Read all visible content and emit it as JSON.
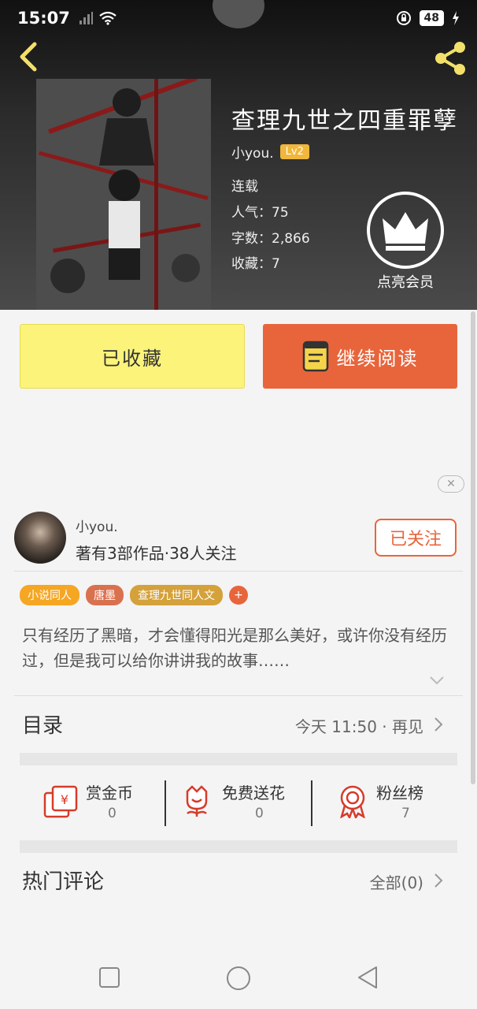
{
  "status": {
    "time": "15:07",
    "battery": "48"
  },
  "book": {
    "title": "查理九世之四重罪孽",
    "author": "小you.",
    "level": "Lv2",
    "state": "连载",
    "popularity_label": "人气：",
    "popularity": "75",
    "words_label": "字数：",
    "words": "2,866",
    "favorites_label": "收藏：",
    "favorites": "7"
  },
  "vip": {
    "label": "点亮会员"
  },
  "actions": {
    "collected": "已收藏",
    "continue_reading": "继续阅读"
  },
  "author_card": {
    "name": "小you.",
    "stats": "著有3部作品·38人关注",
    "follow": "已关注"
  },
  "tags": [
    {
      "label": "小说同人",
      "color": "#f5a623"
    },
    {
      "label": "唐墨",
      "color": "#d9714f"
    },
    {
      "label": "查理九世同人文",
      "color": "#d4a13a"
    },
    {
      "label": "+",
      "color": "#e8653c"
    }
  ],
  "intro": "只有经历了黑暗，才会懂得阳光是那么美好，或许你没有经历过，但是我可以给你讲讲我的故事……",
  "catalog": {
    "title": "目录",
    "latest": "今天 11:50 · 再见"
  },
  "stats": [
    {
      "label": "赏金币",
      "value": "0",
      "icon": "reward-coin-icon"
    },
    {
      "label": "免费送花",
      "value": "0",
      "icon": "flower-icon"
    },
    {
      "label": "粉丝榜",
      "value": "7",
      "icon": "medal-icon"
    }
  ],
  "comments": {
    "title": "热门评论",
    "all": "全部(0)"
  },
  "colors": {
    "accent": "#e8653c",
    "yellow": "#fbf37a"
  }
}
